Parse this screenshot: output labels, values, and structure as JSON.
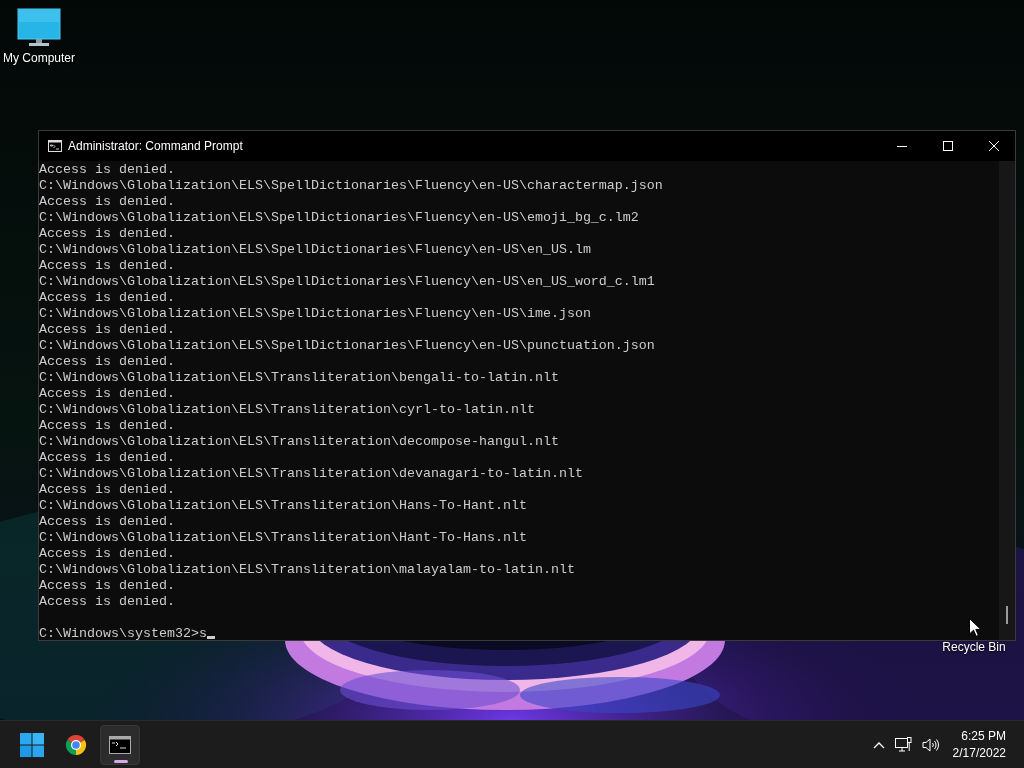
{
  "desktop": {
    "icons": [
      {
        "kind": "computer",
        "label": "My Computer"
      },
      {
        "kind": "recycle-bin",
        "label": "Recycle Bin"
      }
    ]
  },
  "window": {
    "title": "Administrator: Command Prompt",
    "lines": [
      "Access is denied.",
      "C:\\Windows\\Globalization\\ELS\\SpellDictionaries\\Fluency\\en-US\\charactermap.json",
      "Access is denied.",
      "C:\\Windows\\Globalization\\ELS\\SpellDictionaries\\Fluency\\en-US\\emoji_bg_c.lm2",
      "Access is denied.",
      "C:\\Windows\\Globalization\\ELS\\SpellDictionaries\\Fluency\\en-US\\en_US.lm",
      "Access is denied.",
      "C:\\Windows\\Globalization\\ELS\\SpellDictionaries\\Fluency\\en-US\\en_US_word_c.lm1",
      "Access is denied.",
      "C:\\Windows\\Globalization\\ELS\\SpellDictionaries\\Fluency\\en-US\\ime.json",
      "Access is denied.",
      "C:\\Windows\\Globalization\\ELS\\SpellDictionaries\\Fluency\\en-US\\punctuation.json",
      "Access is denied.",
      "C:\\Windows\\Globalization\\ELS\\Transliteration\\bengali-to-latin.nlt",
      "Access is denied.",
      "C:\\Windows\\Globalization\\ELS\\Transliteration\\cyrl-to-latin.nlt",
      "Access is denied.",
      "C:\\Windows\\Globalization\\ELS\\Transliteration\\decompose-hangul.nlt",
      "Access is denied.",
      "C:\\Windows\\Globalization\\ELS\\Transliteration\\devanagari-to-latin.nlt",
      "Access is denied.",
      "C:\\Windows\\Globalization\\ELS\\Transliteration\\Hans-To-Hant.nlt",
      "Access is denied.",
      "C:\\Windows\\Globalization\\ELS\\Transliteration\\Hant-To-Hans.nlt",
      "Access is denied.",
      "C:\\Windows\\Globalization\\ELS\\Transliteration\\malayalam-to-latin.nlt",
      "Access is denied.",
      "Access is denied."
    ],
    "prompt": "C:\\Windows\\system32>",
    "input": "s"
  },
  "taskbar": {
    "apps": [
      {
        "kind": "start",
        "selected": false
      },
      {
        "kind": "browser",
        "selected": false
      },
      {
        "kind": "terminal",
        "selected": true
      }
    ],
    "tray": [
      {
        "kind": "chevron"
      },
      {
        "kind": "network"
      },
      {
        "kind": "volume"
      }
    ],
    "clock": {
      "time": "6:25 PM",
      "date": "2/17/2022"
    }
  }
}
